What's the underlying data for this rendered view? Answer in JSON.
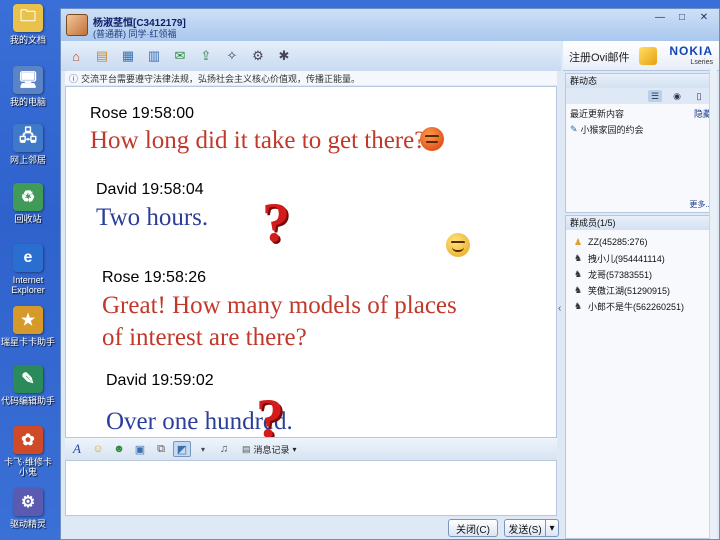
{
  "desktop": {
    "icons": [
      {
        "name": "my-documents",
        "label": "我的文档",
        "glyph": "🗀",
        "color": "#e8c24a"
      },
      {
        "name": "my-computer",
        "label": "我的电脑",
        "glyph": "🖥",
        "color": "#5b84c6"
      },
      {
        "name": "network-places",
        "label": "网上邻居",
        "glyph": "🖧",
        "color": "#3f79c7"
      },
      {
        "name": "recycle-bin",
        "label": "回收站",
        "glyph": "♻",
        "color": "#3f9b57"
      },
      {
        "name": "internet-explorer",
        "label": "Internet\nExplorer",
        "glyph": "e",
        "color": "#2a6fd0"
      },
      {
        "name": "tool-a",
        "label": "瑞星卡卡助手",
        "glyph": "★",
        "color": "#d69a2a"
      },
      {
        "name": "tool-b",
        "label": "代码编辑助手",
        "glyph": "✎",
        "color": "#2a8a5a"
      },
      {
        "name": "tool-c",
        "label": "卡飞·维修卡\n小鬼",
        "glyph": "✿",
        "color": "#d04a2a"
      },
      {
        "name": "tool-d",
        "label": "驱动精灵",
        "glyph": "⚙",
        "color": "#5a5ab0"
      }
    ]
  },
  "window": {
    "title_main": "杨淑茎恒[C3412179]",
    "title_sub": "(普通群) 同学·红领福",
    "controls": {
      "minimize": "—",
      "maximize": "□",
      "close": "✕"
    }
  },
  "notice": "交流平台需要遵守法律法规，弘扬社会主义核心价值观，传播正能量。",
  "chat": {
    "messages": [
      {
        "sender_time": "Rose 19:58:00",
        "text": "How long did it take to get there?"
      },
      {
        "sender_time": "David 19:58:04",
        "text": "Two hours."
      },
      {
        "sender_time": "Rose 19:58:26",
        "text_line1": "Great! How many models of places",
        "text_line2": "of interest are there?"
      },
      {
        "sender_time": "David 19:59:02",
        "text": "Over one hundred."
      }
    ]
  },
  "input_toolbar": {
    "history_label": "消息记录"
  },
  "buttons": {
    "close_label": "关闭(C)",
    "send_label": "发送(S)",
    "send_menu": "▾"
  },
  "side": {
    "register_label": "注册Ovi邮件",
    "nokia": "NOKIA",
    "nokia_sub": "Lseries",
    "activity_title": "群动态",
    "activity_row_left": "最近更新内容",
    "activity_row_right": "隐藏",
    "activity_item": "小猴家园的约会",
    "more_label": "更多...",
    "members_title": "群成员(1/5)",
    "members": [
      "ZZ(45285:276)",
      "拽小儿(954441114)",
      "龙哥(57383551)",
      "笑傲江湖(51290915)",
      "小郎不是牛(562260251)"
    ]
  }
}
